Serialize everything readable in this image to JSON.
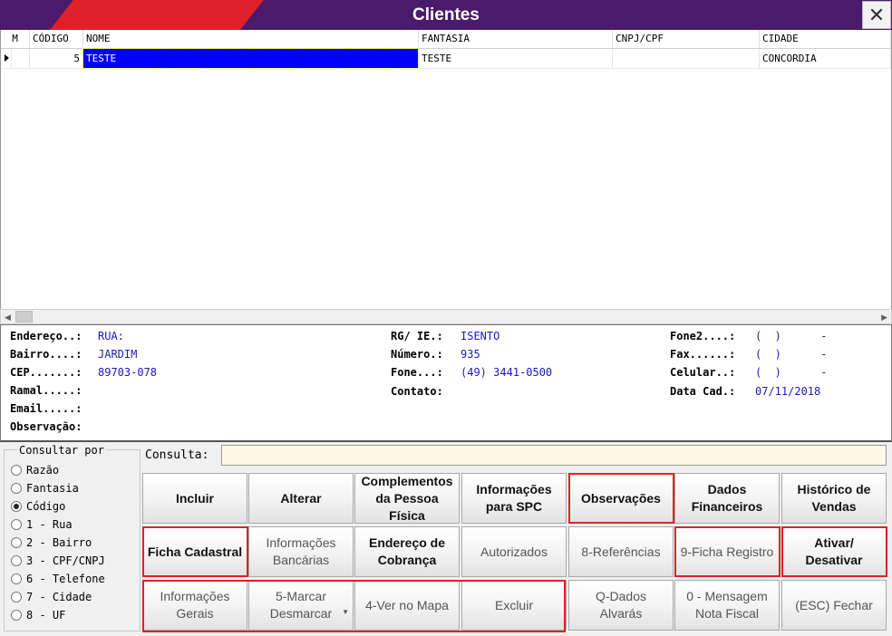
{
  "window": {
    "title": "Clientes",
    "close_glyph": "✕"
  },
  "grid": {
    "headers": [
      "M",
      "CÓDIGO",
      "NOME",
      "FANTASIA",
      "CNPJ/CPF",
      "CIDADE"
    ],
    "rows": [
      {
        "m": "",
        "codigo": "5",
        "nome": "TESTE",
        "fantasia": "TESTE",
        "cnpj": "",
        "cidade": "CONCORDIA"
      }
    ]
  },
  "details": {
    "endereco_label": "Endereço..:",
    "endereco": "RUA:",
    "bairro_label": "Bairro....:",
    "bairro": "JARDIM",
    "cep_label": "CEP.......:",
    "cep": "89703-078",
    "ramal_label": "Ramal.....:",
    "ramal": "",
    "email_label": "Email.....:",
    "email": "",
    "obs_label": "Observação:",
    "obs": "",
    "rg_label": "RG/ IE.:",
    "rg": "ISENTO",
    "numero_label": "Número.:",
    "numero": "935",
    "fone_label": "Fone...:",
    "fone": "(49) 3441-0500",
    "contato_label": "Contato:",
    "contato": "",
    "fone2_label": "Fone2....:",
    "fone2": "(  )      -",
    "fax_label": "Fax......:",
    "fax": "(  )      -",
    "celular_label": "Celular..:",
    "celular": "(  )      -",
    "datacad_label": "Data Cad.:",
    "datacad": "07/11/2018"
  },
  "consult": {
    "title": "Consultar por",
    "options": [
      "Razão",
      "Fantasia",
      "Código",
      "1 - Rua",
      "2 - Bairro",
      "3 - CPF/CNPJ",
      "6 - Telefone",
      "7 - Cidade",
      "8 - UF"
    ],
    "selected": "Código",
    "consulta_label": "Consulta:",
    "consulta_value": ""
  },
  "buttons": {
    "incluir": "Incluir",
    "alterar": "Alterar",
    "complementos": "Complementos\nda Pessoa\nFísica",
    "info_spc": "Informações\npara SPC",
    "observacoes": "Observações",
    "dados_fin": "Dados\nFinanceiros",
    "historico": "Histórico de\nVendas",
    "ficha_cad": "Ficha Cadastral",
    "info_banc": "Informações\nBancárias",
    "end_cobranca": "Endereço de\nCobrança",
    "autorizados": "Autorizados",
    "referencias": "8-Referências",
    "ficha_registro": "9-Ficha Registro",
    "ativar": "Ativar/\nDesativar",
    "info_gerais": "Informações\nGerais",
    "marcar": "5-Marcar\nDesmarcar",
    "ver_mapa": "4-Ver no Mapa",
    "excluir": "Excluir",
    "alvaras": "Q-Dados\nAlvarás",
    "mensagem_nf": "0 - Mensagem\nNota Fiscal",
    "fechar": "(ESC) Fechar"
  },
  "colors": {
    "title_bg": "#4a1a6b",
    "title_accent": "#e0202a",
    "selection": "#0000ff",
    "highlight": "#e0202a"
  }
}
